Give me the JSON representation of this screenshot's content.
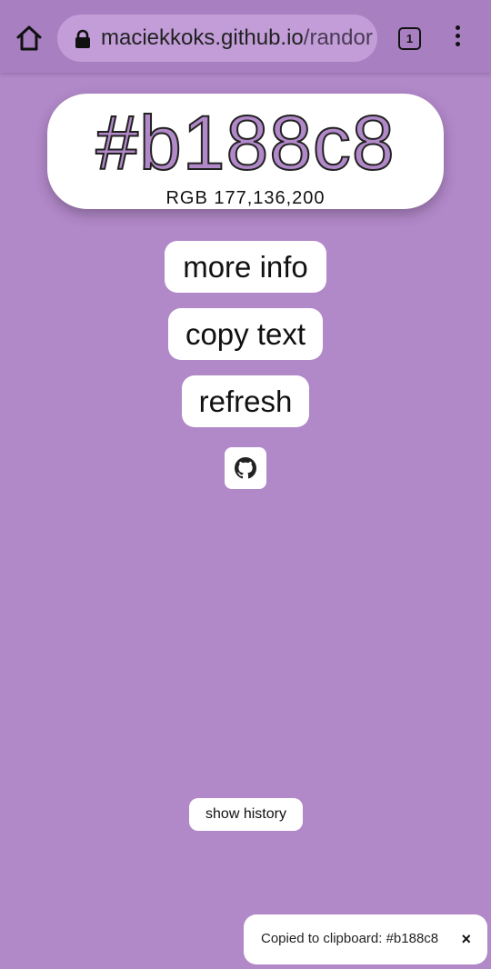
{
  "browser": {
    "url_domain": "maciekkoks.github.io",
    "url_path": "/randor",
    "tab_count": "1"
  },
  "color": {
    "hex": "#b188c8",
    "rgb_label": "RGB 177,136,200",
    "background": "#b188c8"
  },
  "buttons": {
    "more_info": "more info",
    "copy_text": "copy text",
    "refresh": "refresh",
    "github_icon": "github-icon",
    "show_history": "show history"
  },
  "toast": {
    "message": "Copied to clipboard: #b188c8",
    "close": "×"
  }
}
